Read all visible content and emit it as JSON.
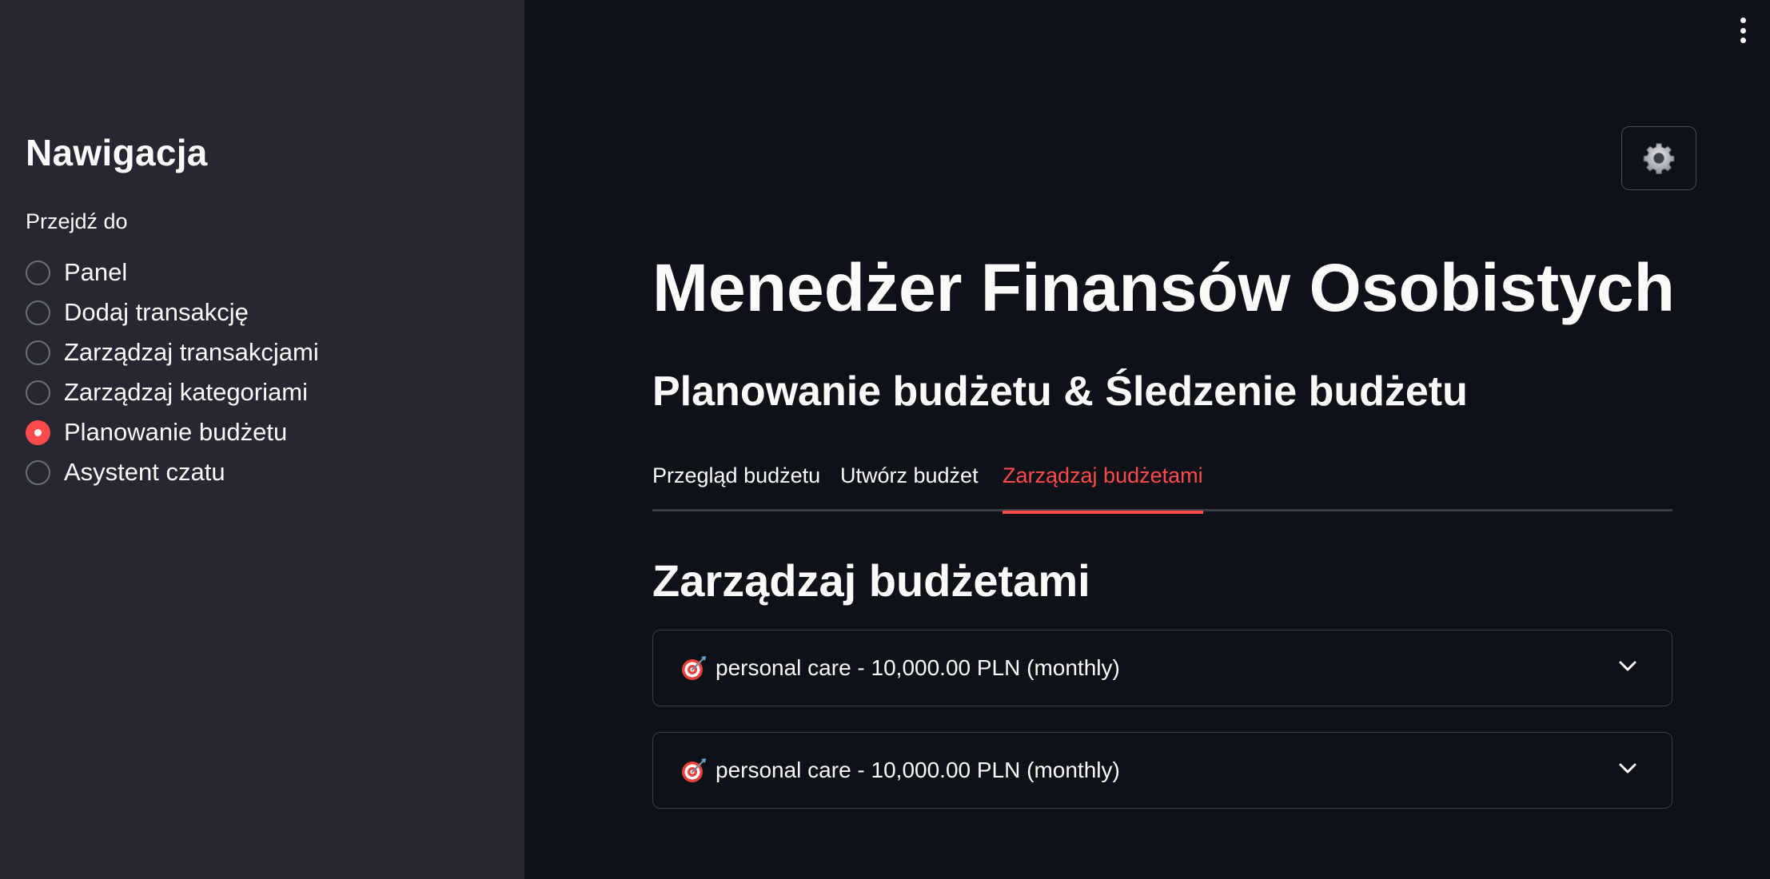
{
  "sidebar": {
    "title": "Nawigacja",
    "radio_label": "Przejdź do",
    "items": [
      {
        "label": "Panel",
        "selected": false
      },
      {
        "label": "Dodaj transakcję",
        "selected": false
      },
      {
        "label": "Zarządzaj transakcjami",
        "selected": false
      },
      {
        "label": "Zarządzaj kategoriami",
        "selected": false
      },
      {
        "label": "Planowanie budżetu",
        "selected": true
      },
      {
        "label": "Asystent czatu",
        "selected": false
      }
    ]
  },
  "header": {
    "settings_icon": "gear-icon",
    "menu_icon": "kebab-menu-icon"
  },
  "main": {
    "title": "Menedżer Finansów Osobistych",
    "subtitle": "Planowanie budżetu & Śledzenie budżetu",
    "tabs": [
      {
        "label": "Przegląd budżetu",
        "active": false
      },
      {
        "label": "Utwórz budżet",
        "active": false
      },
      {
        "label": "Zarządzaj budżetami",
        "active": true
      }
    ],
    "section_title": "Zarządzaj budżetami",
    "budgets": [
      {
        "icon": "target-icon",
        "label": "personal care - 10,000.00 PLN (monthly)"
      },
      {
        "icon": "target-icon",
        "label": "personal care - 10,000.00 PLN (monthly)"
      }
    ]
  },
  "colors": {
    "accent": "#ff4b4b",
    "background": "#0e1117",
    "sidebar_background": "#262730",
    "text": "#fafafa"
  }
}
